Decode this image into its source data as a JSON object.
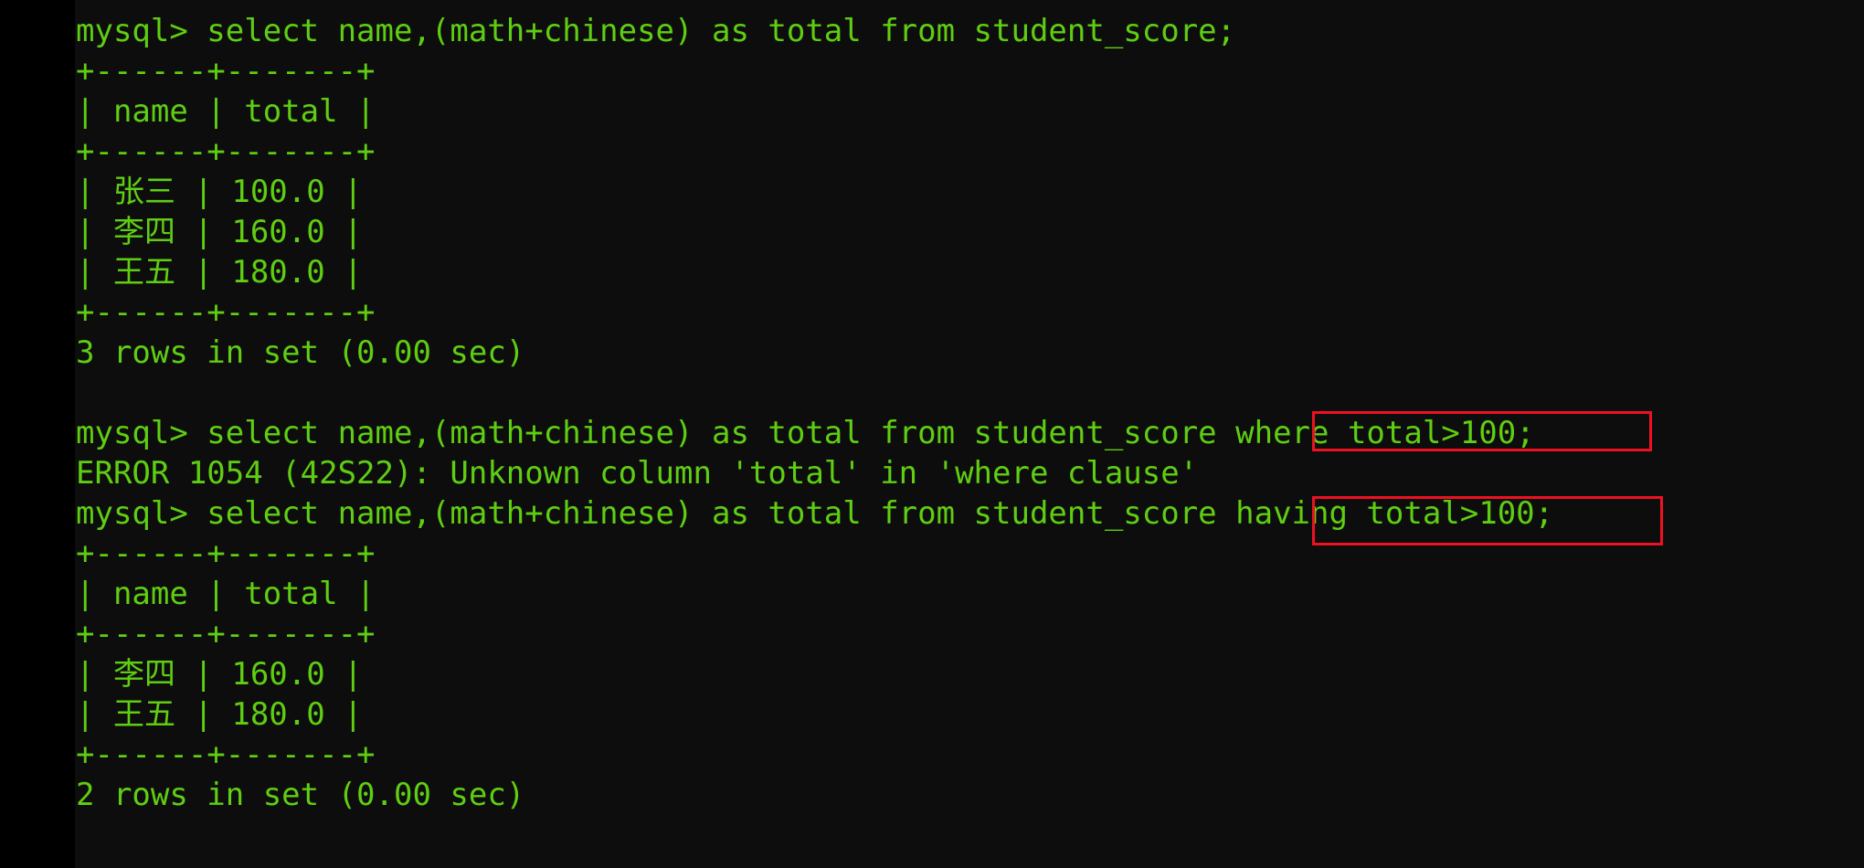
{
  "terminal": {
    "prompt": "mysql>",
    "background_color": "#0d0d0d",
    "gutter_color": "#000000",
    "text_color": "#5fce12",
    "highlight_color": "#ee1122",
    "lines": [
      "mysql> select name,(math+chinese) as total from student_score;",
      "+------+-------+",
      "| name | total |",
      "+------+-------+",
      "| 张三 | 100.0 |",
      "| 李四 | 160.0 |",
      "| 王五 | 180.0 |",
      "+------+-------+",
      "3 rows in set (0.00 sec)",
      "",
      "mysql> select name,(math+chinese) as total from student_score where total>100;",
      "ERROR 1054 (42S22): Unknown column 'total' in 'where clause'",
      "mysql> select name,(math+chinese) as total from student_score having total>100;",
      "+------+-------+",
      "| name | total |",
      "+------+-------+",
      "| 李四 | 160.0 |",
      "| 王五 | 180.0 |",
      "+------+-------+",
      "2 rows in set (0.00 sec)"
    ]
  },
  "queries": {
    "first": "select name,(math+chinese) as total from student_score;",
    "second": "select name,(math+chinese) as total from student_score where total>100;",
    "third": "select name,(math+chinese) as total from student_score having total>100;"
  },
  "error": {
    "code": "ERROR 1054",
    "sqlstate": "42S22",
    "message": "Unknown column 'total' in 'where clause'",
    "full": "ERROR 1054 (42S22): Unknown column 'total' in 'where clause'"
  },
  "result_table_1": {
    "columns": [
      "name",
      "total"
    ],
    "rows": [
      [
        "张三",
        "100.0"
      ],
      [
        "李四",
        "160.0"
      ],
      [
        "王五",
        "180.0"
      ]
    ],
    "status": "3 rows in set (0.00 sec)",
    "row_count": "3",
    "duration": "0.00 sec"
  },
  "result_table_2": {
    "columns": [
      "name",
      "total"
    ],
    "rows": [
      [
        "李四",
        "160.0"
      ],
      [
        "王五",
        "180.0"
      ]
    ],
    "status": "2 rows in set (0.00 sec)",
    "row_count": "2",
    "duration": "0.00 sec"
  },
  "annotations": [
    {
      "id": "box-where",
      "label": "where total>100;",
      "color": "#ee1122"
    },
    {
      "id": "box-having",
      "label": "having total>100;",
      "color": "#ee1122"
    }
  ]
}
